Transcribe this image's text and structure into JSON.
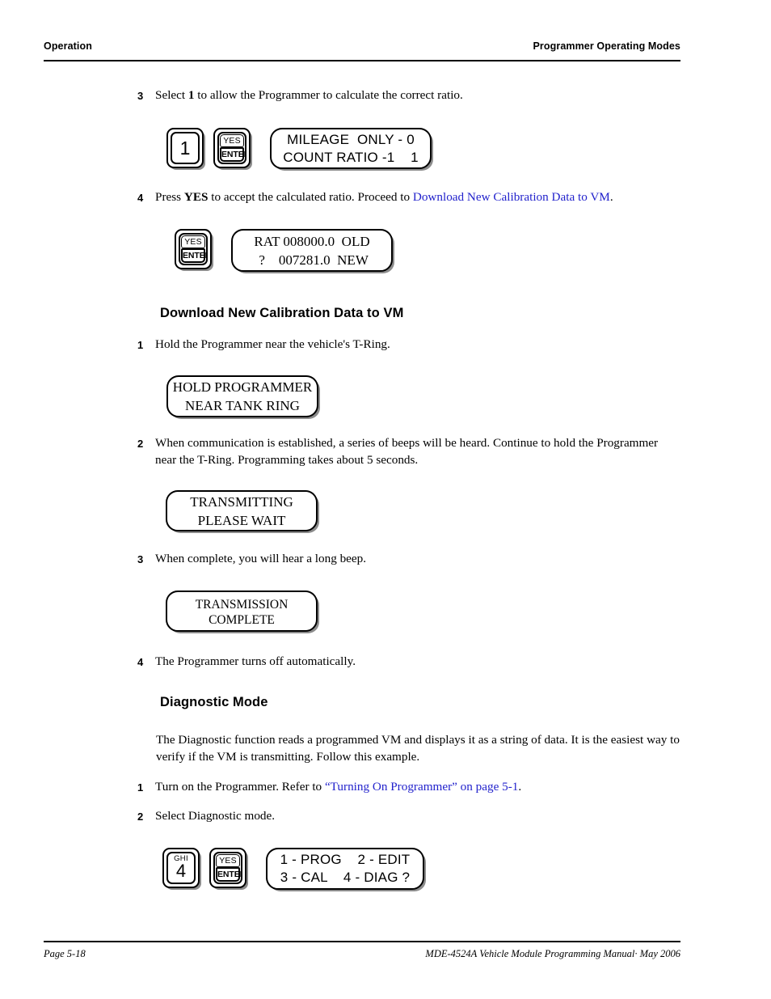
{
  "header": {
    "left": "Operation",
    "right": "Programmer Operating Modes"
  },
  "footer": {
    "left": "Page 5-18",
    "right": "MDE-4524A Vehicle Module Programming Manual· May 2006"
  },
  "steps": {
    "s3_num": "3",
    "s3_pre": "Select ",
    "s3_bold": "1",
    "s3_post": " to allow the Programmer to calculate the correct ratio.",
    "s4_num": "4",
    "s4_pre": "Press ",
    "s4_bold": "YES",
    "s4_mid": " to accept the calculated ratio. Proceed to ",
    "s4_link": "Download New Calibration Data to VM",
    "s4_post": ".",
    "d1_num": "1",
    "d1_text": "Hold the Programmer near the vehicle's T-Ring.",
    "d2_num": "2",
    "d2_text": "When communication is established, a series of beeps will be heard. Continue to hold the Programmer near the T-Ring. Programming takes about 5 seconds.",
    "d3_num": "3",
    "d3_text": "When complete, you will hear a long beep.",
    "d4_num": "4",
    "d4_text": "The Programmer turns off automatically.",
    "g1_num": "1",
    "g1_pre": "Turn on the Programmer. Refer to ",
    "g1_link": "“Turning On Programmer” on page 5-1",
    "g1_post": ".",
    "g2_num": "2",
    "g2_text": "Select Diagnostic mode."
  },
  "headings": {
    "download": "Download New Calibration Data to VM",
    "diagnostic": "Diagnostic Mode"
  },
  "paragraphs": {
    "diagnostic_intro": "The Diagnostic function reads a programmed VM and displays it as a string of data. It is the easiest way to verify if the VM is transmitting. Follow this example."
  },
  "keys": {
    "one": "1",
    "four_alpha": "GHI",
    "four": "4",
    "yes": "YES",
    "enter": "ENTER"
  },
  "displays": {
    "mileage": {
      "line1": "MILEAGE  ONLY - 0",
      "line2": "COUNT RATIO -1    1"
    },
    "ratio": {
      "line1": "RAT 008000.0  OLD",
      "line2": " ?    007281.0  NEW"
    },
    "hold": {
      "line1": "HOLD PROGRAMMER",
      "line2": "NEAR TANK RING"
    },
    "transmitting": {
      "line1": "TRANSMITTING",
      "line2": "PLEASE WAIT"
    },
    "complete": {
      "line1": "TRANSMISSION",
      "line2": "COMPLETE"
    },
    "menu": {
      "line1": "1 - PROG    2 - EDIT",
      "line2": "3 - CAL    4 - DIAG ?"
    }
  },
  "colors": {
    "link": "#2222cc",
    "rule": "#000000",
    "shadow": "#8c8c8c"
  }
}
